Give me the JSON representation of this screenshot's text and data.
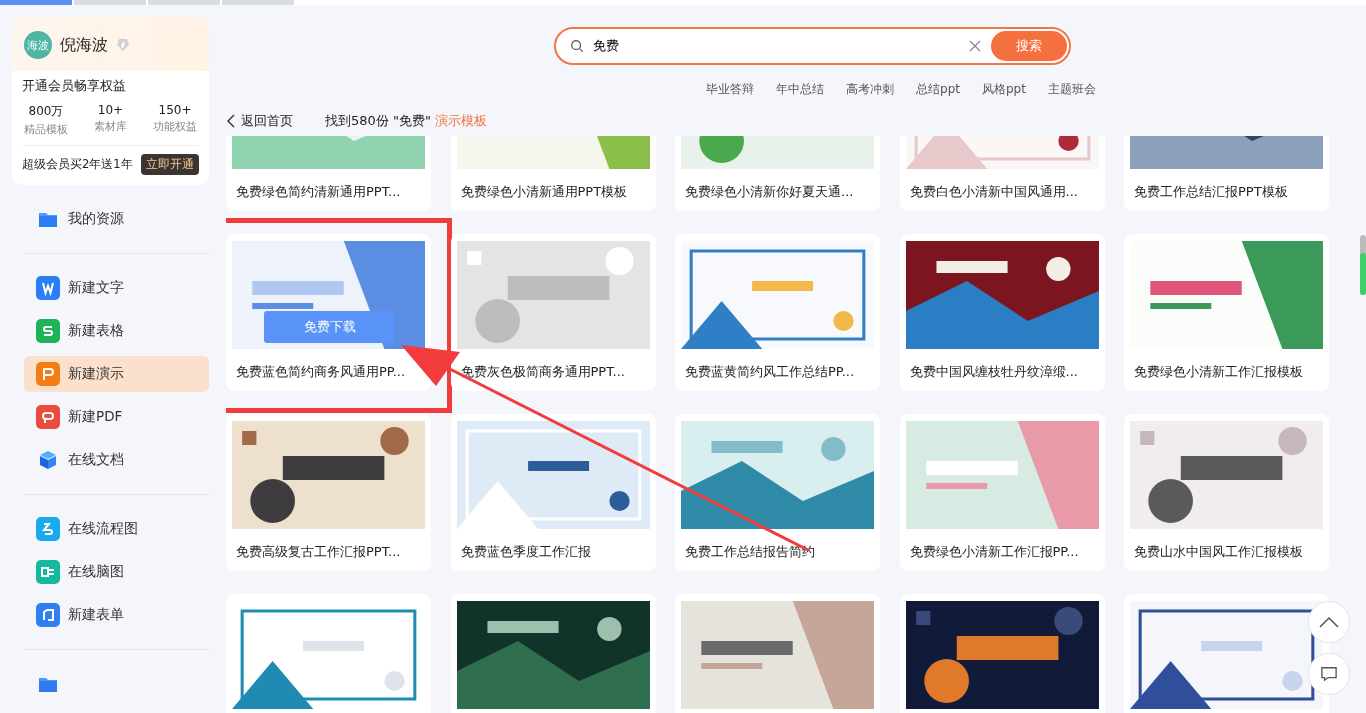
{
  "sidebar": {
    "user": {
      "avatar": "海波",
      "name": "倪海波"
    },
    "promo": {
      "title": "开通会员畅享权益",
      "stats": [
        {
          "value": "800万",
          "label": "精品模板"
        },
        {
          "value": "10+",
          "label": "素材库"
        },
        {
          "value": "150+",
          "label": "功能权益"
        }
      ],
      "offer": "超级会员买2年送1年",
      "button": "立即开通"
    },
    "sections": [
      [
        {
          "label": "我的资源",
          "kind": "folder",
          "selected": false
        }
      ],
      [
        {
          "label": "新建文字",
          "kind": "doc",
          "selected": false
        },
        {
          "label": "新建表格",
          "kind": "sheet",
          "selected": false
        },
        {
          "label": "新建演示",
          "kind": "slides",
          "selected": true
        },
        {
          "label": "新建PDF",
          "kind": "pdf",
          "selected": false
        },
        {
          "label": "在线文档",
          "kind": "cube",
          "selected": false
        }
      ],
      [
        {
          "label": "在线流程图",
          "kind": "flow",
          "selected": false
        },
        {
          "label": "在线脑图",
          "kind": "mind",
          "selected": false
        },
        {
          "label": "新建表单",
          "kind": "form",
          "selected": false
        }
      ],
      [
        {
          "kind": "folder",
          "selected": false
        }
      ]
    ]
  },
  "search": {
    "value": "免费",
    "button": "搜索"
  },
  "hot_tags": [
    "毕业答辩",
    "年中总结",
    "高考冲刺",
    "总结ppt",
    "风格ppt",
    "主题班会"
  ],
  "breadcrumb": {
    "back": "返回首页",
    "result": "找到580份 \"免费\"",
    "category": "演示模板"
  },
  "rows": [
    [
      {
        "title": "免费绿色简约清新通用PPT..."
      },
      {
        "title": "免费绿色小清新通用PPT模板"
      },
      {
        "title": "免费绿色小清新你好夏天通..."
      },
      {
        "title": "免费白色小清新中国风通用..."
      },
      {
        "title": "免费工作总结汇报PPT模板"
      }
    ],
    [
      {
        "title": "免费蓝色简约商务风通用PP...",
        "highlighted": true,
        "action": "免费下载"
      },
      {
        "title": "免费灰色极简商务通用PPT..."
      },
      {
        "title": "免费蓝黄简约风工作总结PP..."
      },
      {
        "title": "免费中国风缠枝牡丹纹漳缎..."
      },
      {
        "title": "免费绿色小清新工作汇报模板"
      }
    ],
    [
      {
        "title": "免费高级复古工作汇报PPT..."
      },
      {
        "title": "免费蓝色季度工作汇报"
      },
      {
        "title": "免费工作总结报告简约"
      },
      {
        "title": "免费绿色小清新工作汇报PP..."
      },
      {
        "title": "免费山水中国风工作汇报模板"
      }
    ],
    [
      {
        "kind": "picture"
      },
      {
        "kind": "picture"
      },
      {
        "kind": "picture"
      },
      {
        "kind": "picture"
      },
      {
        "kind": "picture"
      }
    ]
  ]
}
